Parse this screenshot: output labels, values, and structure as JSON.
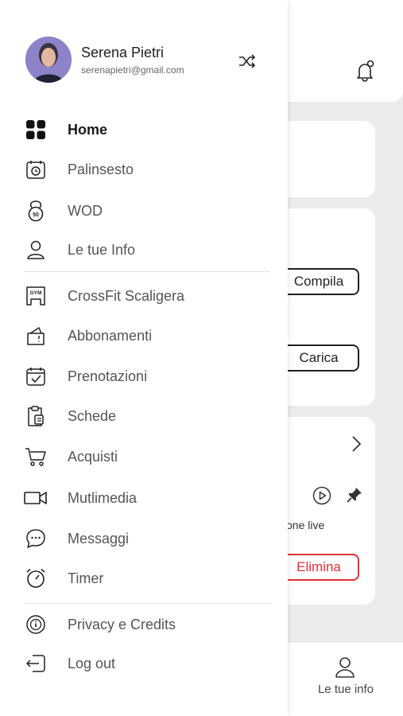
{
  "user": {
    "name": "Serena Pietri",
    "email": "serenapietri@gmail.com",
    "switch_icon": "shuffle-icon"
  },
  "menu": {
    "group1": [
      {
        "label": "Home",
        "icon": "grid-icon",
        "active": true
      },
      {
        "label": "Palinsesto",
        "icon": "calendar-clock-icon"
      },
      {
        "label": "WOD",
        "icon": "kettlebell-icon"
      },
      {
        "label": "Le tue Info",
        "icon": "person-icon"
      }
    ],
    "group2": [
      {
        "label": "CrossFit Scaligera",
        "icon": "gym-icon"
      },
      {
        "label": "Abbonamenti",
        "icon": "wallet-icon"
      },
      {
        "label": "Prenotazioni",
        "icon": "calendar-check-icon"
      },
      {
        "label": "Schede",
        "icon": "clipboard-icon"
      },
      {
        "label": "Acquisti",
        "icon": "cart-icon"
      },
      {
        "label": "Mutlimedia",
        "icon": "video-icon"
      },
      {
        "label": "Messaggi",
        "icon": "chat-icon"
      },
      {
        "label": "Timer",
        "icon": "timer-icon"
      }
    ],
    "group3": [
      {
        "label": "Privacy e Credits",
        "icon": "info-icon"
      },
      {
        "label": "Log out",
        "icon": "logout-icon"
      }
    ]
  },
  "background": {
    "compila_label": "Compila",
    "carica_label": "Carica",
    "elimina_label": "Elimina",
    "live_text": "one live",
    "bottom_nav_label": "Le tue info"
  },
  "colors": {
    "accent_red": "#e0303a",
    "avatar_bg": "#8d83c9"
  }
}
